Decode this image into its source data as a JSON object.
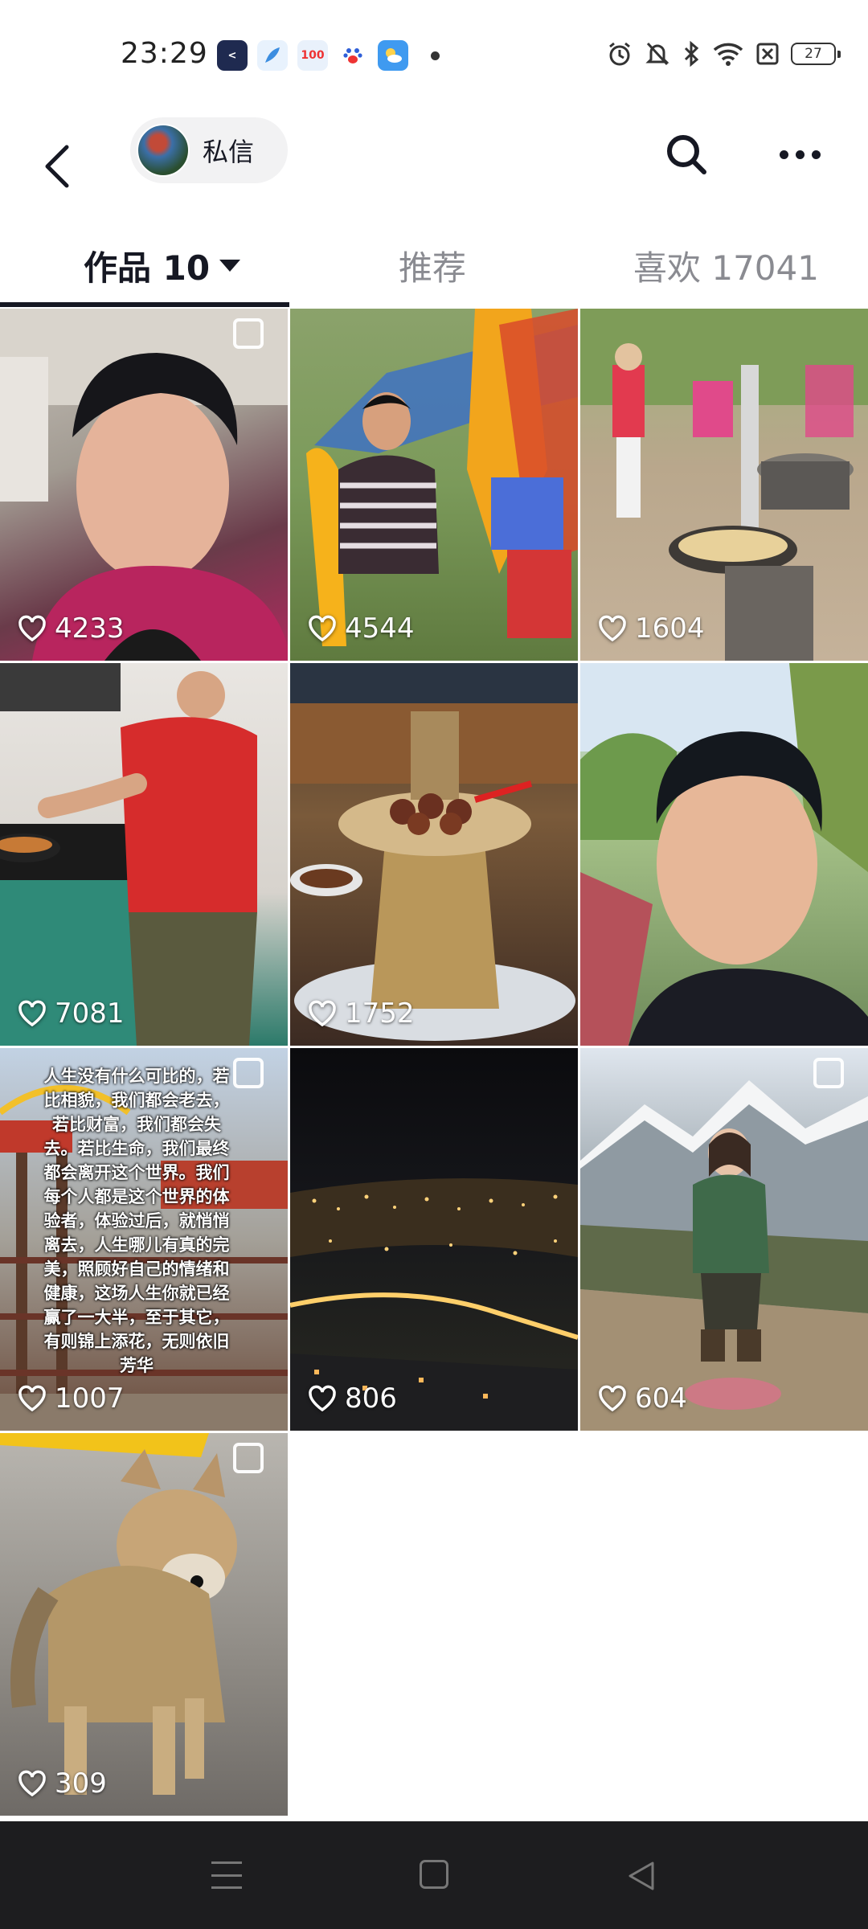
{
  "status_bar": {
    "time": "23:29",
    "apps": [
      {
        "icon": "chevron-app-icon",
        "color": "#1f2a50",
        "glyph": "<"
      },
      {
        "icon": "feather-app-icon",
        "color": "#3b8de0",
        "glyph": ""
      },
      {
        "icon": "hundred-app-icon",
        "color": "#e9f1fb",
        "glyph": "100"
      },
      {
        "icon": "paw-app-icon",
        "color": "#ffffff",
        "glyph": ""
      },
      {
        "icon": "weather-app-icon",
        "color": "#3f9af0",
        "glyph": ""
      }
    ],
    "battery": "27"
  },
  "header": {
    "message_label": "私信"
  },
  "tabs": {
    "works": "作品 10",
    "recommend": "推荐",
    "likes": "喜欢 17041"
  },
  "posts": [
    {
      "likes": "4233",
      "multi": true
    },
    {
      "likes": "4544",
      "multi": false
    },
    {
      "likes": "1604",
      "multi": false
    },
    {
      "likes": "7081",
      "multi": false
    },
    {
      "likes": "1752",
      "multi": false
    },
    {
      "likes": "",
      "multi": false
    },
    {
      "likes": "1007",
      "multi": true,
      "overlay": "人生没有什么可比的，若比相貌，我们都会老去，若比财富，我们都会失去。若比生命，我们最终都会离开这个世界。我们每个人都是这个世界的体验者，体验过后，就悄悄离去，人生哪儿有真的完美，照顾好自己的情绪和健康，这场人生你就已经赢了一大半，至于其它，有则锦上添花，无则依旧芳华"
    },
    {
      "likes": "806",
      "multi": false
    },
    {
      "likes": "604",
      "multi": true
    },
    {
      "likes": "309",
      "multi": true
    }
  ],
  "colors": {
    "accent": "#161823",
    "inactive_tab": "#8a8b91",
    "nav_bar": "#1d1d1f"
  }
}
